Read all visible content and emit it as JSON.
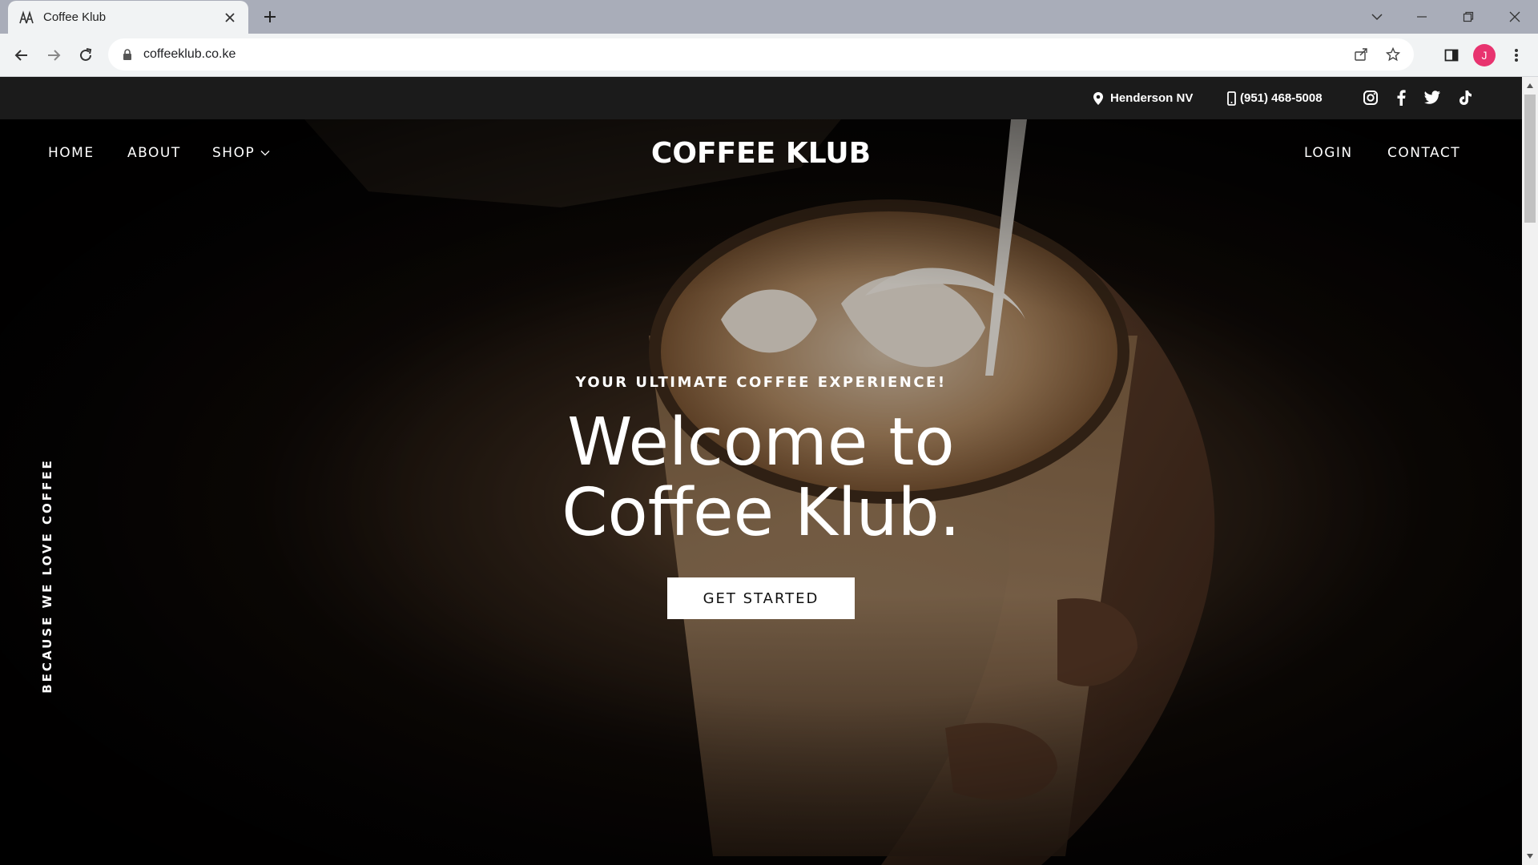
{
  "browser": {
    "tab": {
      "title": "Coffee Klub",
      "favicon": "coffee-klub-favicon",
      "close_icon": "close-icon"
    },
    "new_tab_icon": "plus-icon",
    "window_controls": [
      "chevron-down-icon",
      "minimize-icon",
      "restore-icon",
      "close-icon"
    ],
    "toolbar": {
      "back_icon": "arrow-left-icon",
      "forward_icon": "arrow-right-icon",
      "reload_icon": "reload-icon"
    },
    "address": {
      "url": "coffeeklub.co.ke",
      "lock_icon": "lock-icon"
    },
    "omnibox_icons": [
      "share-icon",
      "star-icon"
    ],
    "side_panel_icon": "side-panel-icon",
    "profile_initial": "J",
    "profile_color": "#e8336f",
    "menu_icon": "kebab-menu-icon"
  },
  "topbar": {
    "location": {
      "icon": "location-pin-icon",
      "text": "Henderson NV"
    },
    "phone": {
      "icon": "phone-icon",
      "text": "(951) 468-5008"
    },
    "social": [
      "instagram-icon",
      "facebook-icon",
      "twitter-icon",
      "tiktok-icon"
    ]
  },
  "nav": {
    "left": [
      "HOME",
      "ABOUT",
      "SHOP"
    ],
    "shop_dropdown_icon": "chevron-down-icon",
    "brand": "COFFEE KLUB",
    "right": [
      "LOGIN",
      "CONTACT"
    ]
  },
  "hero": {
    "side_text": "BECAUSE WE LOVE COFFEE",
    "subtitle": "YOUR ULTIMATE COFFEE EXPERIENCE!",
    "headline_line1": "Welcome to",
    "headline_line2": "Coffee Klub.",
    "cta": "GET STARTED"
  }
}
